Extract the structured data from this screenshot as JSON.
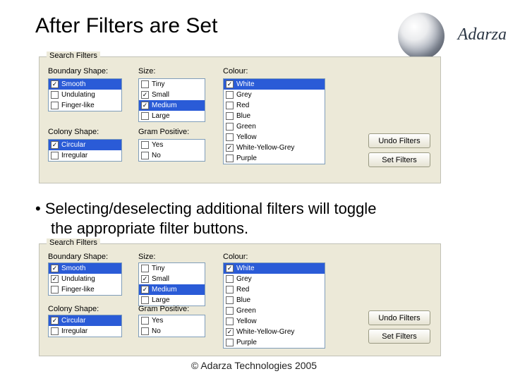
{
  "title": "After Filters are Set",
  "brand": "Adarza",
  "fieldset_label": "Search Filters",
  "labels": {
    "boundary": "Boundary Shape:",
    "colony": "Colony Shape:",
    "size": "Size:",
    "gram": "Gram Positive:",
    "colour": "Colour:"
  },
  "boundary": {
    "items": [
      {
        "label": "Smooth",
        "checked": true,
        "selected": true
      },
      {
        "label": "Undulating",
        "checked": false,
        "selected": false
      },
      {
        "label": "Finger-like",
        "checked": false,
        "selected": false
      }
    ]
  },
  "colony": {
    "items": [
      {
        "label": "Circular",
        "checked": true,
        "selected": true
      },
      {
        "label": "Irregular",
        "checked": false,
        "selected": false
      }
    ]
  },
  "size": {
    "items": [
      {
        "label": "Tiny",
        "checked": false,
        "selected": false
      },
      {
        "label": "Small",
        "checked": true,
        "selected": false
      },
      {
        "label": "Medium",
        "checked": true,
        "selected": true
      },
      {
        "label": "Large",
        "checked": false,
        "selected": false
      }
    ]
  },
  "gram": {
    "items": [
      {
        "label": "Yes",
        "checked": false,
        "selected": false
      },
      {
        "label": "No",
        "checked": false,
        "selected": false
      }
    ]
  },
  "colour": {
    "items": [
      {
        "label": "White",
        "checked": true,
        "selected": true
      },
      {
        "label": "Grey",
        "checked": false,
        "selected": false
      },
      {
        "label": "Red",
        "checked": false,
        "selected": false
      },
      {
        "label": "Blue",
        "checked": false,
        "selected": false
      },
      {
        "label": "Green",
        "checked": false,
        "selected": false
      },
      {
        "label": "Yellow",
        "checked": false,
        "selected": false
      },
      {
        "label": "White-Yellow-Grey",
        "checked": true,
        "selected": false
      },
      {
        "label": "Purple",
        "checked": false,
        "selected": false
      }
    ]
  },
  "buttons": {
    "undo": "Undo Filters",
    "set": "Set Filters"
  },
  "bullet_line1": "Selecting/deselecting additional filters will toggle",
  "bullet_line2": "the appropriate filter buttons.",
  "panel_bottom": {
    "boundary": [
      {
        "label": "Smooth",
        "checked": true,
        "selected": true
      },
      {
        "label": "Undulating",
        "checked": true,
        "selected": false
      },
      {
        "label": "Finger-like",
        "checked": false,
        "selected": false
      }
    ],
    "colony": [
      {
        "label": "Circular",
        "checked": true,
        "selected": true
      },
      {
        "label": "Irregular",
        "checked": false,
        "selected": false
      }
    ],
    "size": [
      {
        "label": "Tiny",
        "checked": false,
        "selected": false
      },
      {
        "label": "Small",
        "checked": true,
        "selected": false
      },
      {
        "label": "Medium",
        "checked": true,
        "selected": true
      },
      {
        "label": "Large",
        "checked": false,
        "selected": false
      }
    ],
    "gram": [
      {
        "label": "Yes",
        "checked": false,
        "selected": false
      },
      {
        "label": "No",
        "checked": false,
        "selected": false
      }
    ],
    "colour": [
      {
        "label": "White",
        "checked": true,
        "selected": true
      },
      {
        "label": "Grey",
        "checked": false,
        "selected": false
      },
      {
        "label": "Red",
        "checked": false,
        "selected": false
      },
      {
        "label": "Blue",
        "checked": false,
        "selected": false
      },
      {
        "label": "Green",
        "checked": false,
        "selected": false
      },
      {
        "label": "Yellow",
        "checked": false,
        "selected": false
      },
      {
        "label": "White-Yellow-Grey",
        "checked": true,
        "selected": false
      },
      {
        "label": "Purple",
        "checked": false,
        "selected": false
      }
    ]
  },
  "copyright": "© Adarza Technologies 2005"
}
